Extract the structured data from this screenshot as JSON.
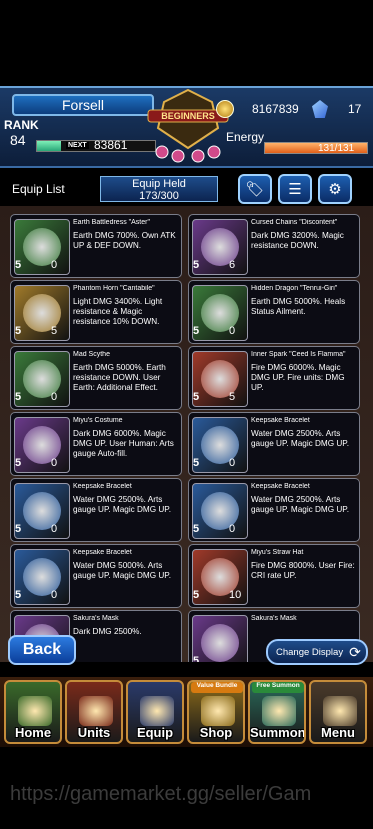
{
  "header": {
    "player_name": "Forsell",
    "rank_label": "RANK",
    "rank_value": "84",
    "next_label": "NEXT",
    "next_value": "83861",
    "xp_progress": 0.2,
    "logo_text": "BEGINNERS",
    "gold": "8167839",
    "gems": "17",
    "energy_label": "Energy",
    "energy_value": "131/131",
    "energy_progress": 1.0
  },
  "toolbar": {
    "equip_list_label": "Equip List",
    "held_label": "Equip Held",
    "held_value": "173/300",
    "tag_icon": "tag-icon",
    "sort_icon": "sort-icon",
    "settings_icon": "gear-icon"
  },
  "items": [
    {
      "title": "Earth Battledress \"Aster\"",
      "desc": "Earth DMG 700%. Own ATK UP & DEF DOWN.",
      "stars": "5",
      "level": "0",
      "color": "#3a7a3a"
    },
    {
      "title": "Cursed Chains \"Discontent\"",
      "desc": "Dark DMG 3200%. Magic resistance DOWN.",
      "stars": "5",
      "level": "6",
      "color": "#6a3a8a"
    },
    {
      "title": "Phantom Horn \"Cantabile\"",
      "desc": "Light DMG 3400%. Light resistance & Magic resistance 10% DOWN.",
      "stars": "5",
      "level": "5",
      "color": "#a07a2a"
    },
    {
      "title": "Hidden Dragon \"Tenrui-Giri\"",
      "desc": "Earth DMG 5000%. Heals Status Ailment.",
      "stars": "5",
      "level": "0",
      "color": "#3a7a3a"
    },
    {
      "title": "Mad Scythe",
      "desc": "Earth DMG 5000%. Earth resistance DOWN. User Earth: Additional Effect.",
      "stars": "5",
      "level": "0",
      "color": "#3a7a3a"
    },
    {
      "title": "Inner Spark \"Ceed Is Flamma\"",
      "desc": "Fire DMG 6000%. Magic DMG UP. Fire units: DMG UP.",
      "stars": "5",
      "level": "5",
      "color": "#a03a2a"
    },
    {
      "title": "Miyu's Costume",
      "desc": "Dark DMG 6000%. Magic DMG UP. User Human: Arts gauge Auto-fill.",
      "stars": "5",
      "level": "0",
      "color": "#6a3a8a"
    },
    {
      "title": "Keepsake Bracelet",
      "desc": "Water DMG 2500%. Arts gauge UP. Magic DMG UP.",
      "stars": "5",
      "level": "0",
      "color": "#2a5a9a"
    },
    {
      "title": "Keepsake Bracelet",
      "desc": "Water DMG 2500%. Arts gauge UP. Magic DMG UP.",
      "stars": "5",
      "level": "0",
      "color": "#2a5a9a"
    },
    {
      "title": "Keepsake Bracelet",
      "desc": "Water DMG 2500%. Arts gauge UP. Magic DMG UP.",
      "stars": "5",
      "level": "0",
      "color": "#2a5a9a"
    },
    {
      "title": "Keepsake Bracelet",
      "desc": "Water DMG 5000%. Arts gauge UP. Magic DMG UP.",
      "stars": "5",
      "level": "0",
      "color": "#2a5a9a"
    },
    {
      "title": "Miyu's Straw Hat",
      "desc": "Fire DMG 8000%. User Fire: CRI rate UP.",
      "stars": "5",
      "level": "10",
      "color": "#a03a2a"
    },
    {
      "title": "Sakura's Mask",
      "desc": "Dark DMG 2500%.",
      "stars": "5",
      "level": "",
      "color": "#6a3a8a"
    },
    {
      "title": "Sakura's Mask",
      "desc": "",
      "stars": "5",
      "level": "",
      "color": "#6a3a8a"
    }
  ],
  "actions": {
    "back_label": "Back",
    "change_display_label": "Change Display"
  },
  "nav": [
    {
      "label": "Home",
      "badge": "",
      "bg": "#3a6a2a"
    },
    {
      "label": "Units",
      "badge": "",
      "bg": "#7a2a1a"
    },
    {
      "label": "Equip",
      "badge": "",
      "bg": "#2a3a6a"
    },
    {
      "label": "Shop",
      "badge": "Value Bundle",
      "bg": "#8a6a1a",
      "badge_color": "#d67a10"
    },
    {
      "label": "Summon",
      "badge": "Free Summon",
      "bg": "#2a6a5a",
      "badge_color": "#2a8a3a"
    },
    {
      "label": "Menu",
      "badge": "",
      "bg": "#4a3a2a"
    }
  ],
  "watermark": "https://gamemarket.gg/seller/Gam"
}
